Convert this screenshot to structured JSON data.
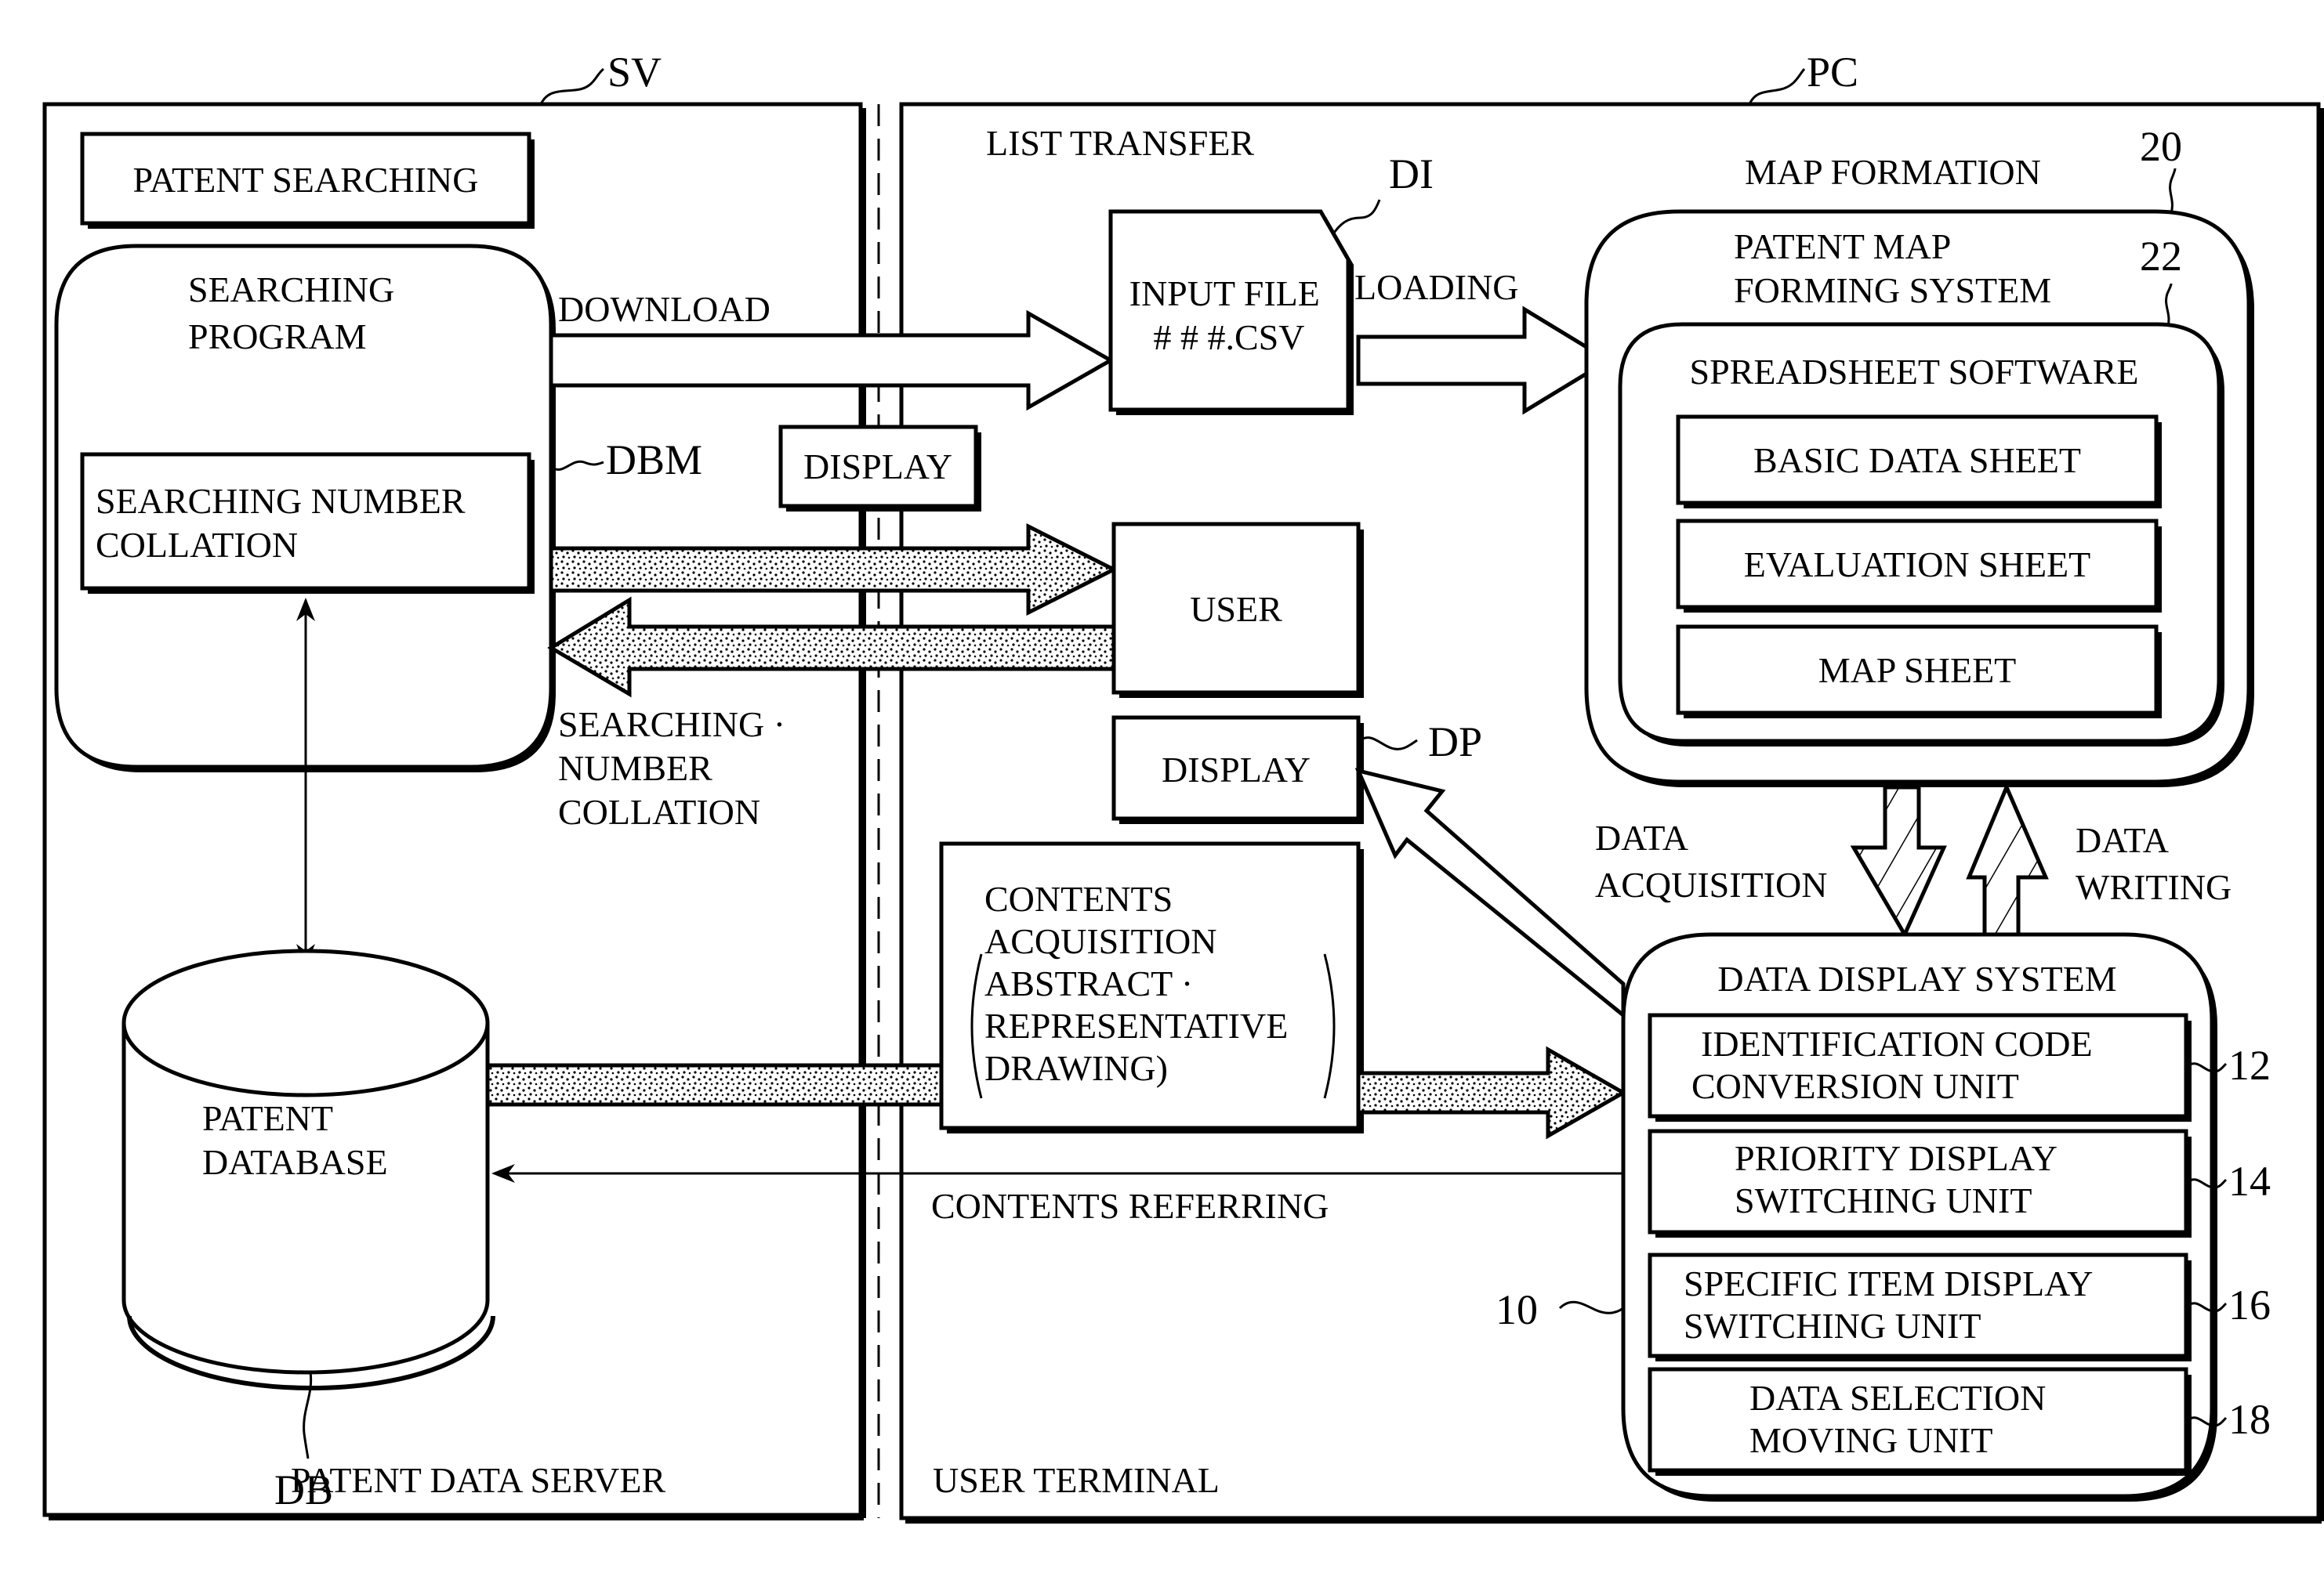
{
  "figure": {
    "colors": {
      "ink": "#000000",
      "paper": "#ffffff"
    },
    "server": {
      "ref": "SV",
      "title": "PATENT DATA SERVER",
      "patent_searching": "PATENT SEARCHING",
      "searching_program": [
        "SEARCHING",
        "PROGRAM"
      ],
      "dbm_ref": "DBM",
      "searching_number_collation": [
        "SEARCHING  NUMBER",
        "COLLATION"
      ],
      "database": [
        "PATENT",
        "DATABASE"
      ],
      "db_ref": "DB"
    },
    "terminal": {
      "ref": "PC",
      "title": "USER TERMINAL",
      "list_transfer": "LIST TRANSFER",
      "map_formation": "MAP FORMATION",
      "input_file": [
        "INPUT FILE",
        "# # #.CSV"
      ],
      "di_ref": "DI",
      "user": "USER",
      "display_top": "DISPLAY",
      "display_dp": "DISPLAY",
      "dp_ref": "DP",
      "contents_box": [
        "CONTENTS",
        "ACQUISITION",
        "ABSTRACT ·",
        "REPRESENTATIVE",
        "DRAWING)"
      ],
      "map_system": {
        "ref": "20",
        "title": [
          "PATENT MAP",
          "FORMING SYSTEM"
        ],
        "spreadsheet": {
          "ref": "22",
          "title": "SPREADSHEET  SOFTWARE",
          "sheets": [
            "BASIC  DATA  SHEET",
            "EVALUATION  SHEET",
            "MAP  SHEET"
          ]
        }
      },
      "data_display_system": {
        "ref": "10",
        "title": "DATA  DISPLAY  SYSTEM",
        "units": [
          {
            "ref": "12",
            "lines": [
              "IDENTIFICATION  CODE",
              "CONVERSION  UNIT"
            ]
          },
          {
            "ref": "14",
            "lines": [
              "PRIORITY  DISPLAY",
              "SWITCHING  UNIT"
            ]
          },
          {
            "ref": "16",
            "lines": [
              "SPECIFIC  ITEM  DISPLAY",
              "SWITCHING  UNIT"
            ]
          },
          {
            "ref": "18",
            "lines": [
              "DATA  SELECTION",
              "MOVING  UNIT"
            ]
          }
        ]
      }
    },
    "flows": {
      "download": "DOWNLOAD",
      "loading": "LOADING",
      "searching_number_collation": [
        "SEARCHING ·",
        "NUMBER",
        "COLLATION"
      ],
      "data_acquisition": [
        "DATA",
        "ACQUISITION"
      ],
      "data_writing": [
        "DATA",
        "WRITING"
      ],
      "contents_referring": "CONTENTS  REFERRING"
    }
  }
}
